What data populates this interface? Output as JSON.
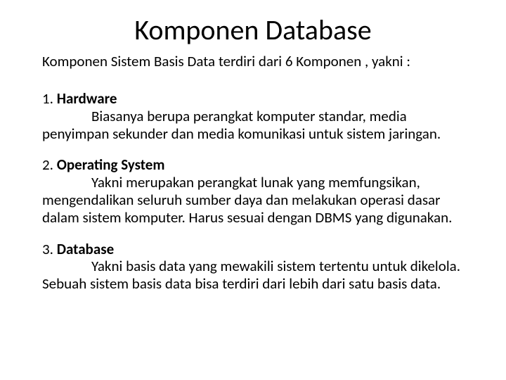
{
  "title": "Komponen Database",
  "intro": "Komponen Sistem Basis Data terdiri dari 6 Komponen , yakni :",
  "items": [
    {
      "num": "1. ",
      "name": "Hardware",
      "desc": "Biasanya berupa perangkat komputer standar, media penyimpan sekunder dan media komunikasi untuk sistem jaringan."
    },
    {
      "num": "2. ",
      "name": "Operating System",
      "desc": "Yakni merupakan perangkat lunak yang memfungsikan, mengendalikan seluruh sumber daya dan melakukan operasi dasar dalam sistem komputer. Harus sesuai dengan DBMS yang digunakan."
    },
    {
      "num": "3. ",
      "name": "Database",
      "desc": "Yakni basis data yang mewakili sistem tertentu untuk dikelola. Sebuah sistem basis data bisa terdiri dari lebih dari satu basis data."
    }
  ]
}
